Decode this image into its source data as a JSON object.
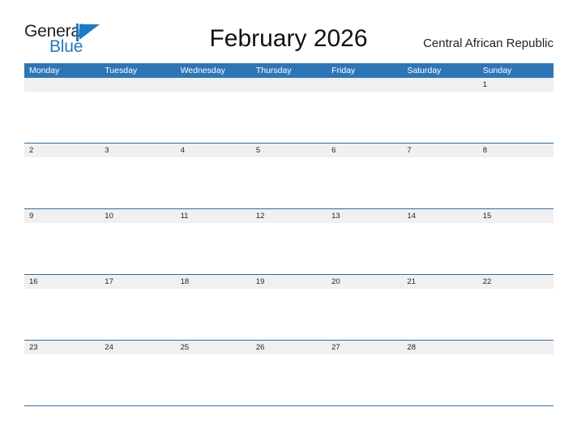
{
  "brand": {
    "name_part1": "General",
    "name_part2": "Blue",
    "flag_icon": "blue-triangle-flag-icon",
    "blue_color": "#1f7ac4",
    "dark_color": "#231f20"
  },
  "header": {
    "title": "February 2026",
    "region": "Central African Republic"
  },
  "theme": {
    "header_blue": "#2e75b6",
    "row_border_blue": "#2e6da4",
    "day_band_gray": "#f0f0f0",
    "cell_white": "#ffffff"
  },
  "calendar": {
    "weekdays": [
      "Monday",
      "Tuesday",
      "Wednesday",
      "Thursday",
      "Friday",
      "Saturday",
      "Sunday"
    ],
    "weeks": [
      {
        "days": [
          {
            "number": ""
          },
          {
            "number": ""
          },
          {
            "number": ""
          },
          {
            "number": ""
          },
          {
            "number": ""
          },
          {
            "number": ""
          },
          {
            "number": "1"
          }
        ]
      },
      {
        "days": [
          {
            "number": "2"
          },
          {
            "number": "3"
          },
          {
            "number": "4"
          },
          {
            "number": "5"
          },
          {
            "number": "6"
          },
          {
            "number": "7"
          },
          {
            "number": "8"
          }
        ]
      },
      {
        "days": [
          {
            "number": "9"
          },
          {
            "number": "10"
          },
          {
            "number": "11"
          },
          {
            "number": "12"
          },
          {
            "number": "13"
          },
          {
            "number": "14"
          },
          {
            "number": "15"
          }
        ]
      },
      {
        "days": [
          {
            "number": "16"
          },
          {
            "number": "17"
          },
          {
            "number": "18"
          },
          {
            "number": "19"
          },
          {
            "number": "20"
          },
          {
            "number": "21"
          },
          {
            "number": "22"
          }
        ]
      },
      {
        "days": [
          {
            "number": "23"
          },
          {
            "number": "24"
          },
          {
            "number": "25"
          },
          {
            "number": "26"
          },
          {
            "number": "27"
          },
          {
            "number": "28"
          },
          {
            "number": ""
          }
        ]
      }
    ]
  }
}
